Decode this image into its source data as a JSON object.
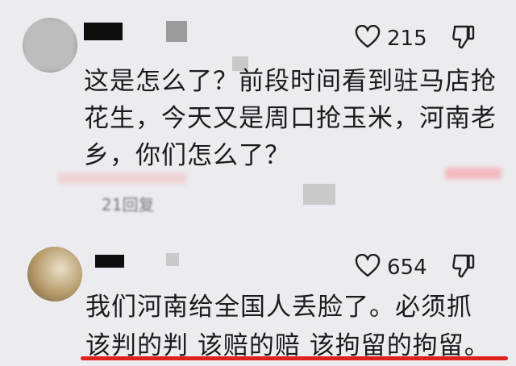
{
  "comments": [
    {
      "likes": "215",
      "text": "这是怎么了？前段时间看到驻马店抢\n花生，今天又是周口抢玉米，河南老\n乡，你们怎么了？",
      "replies": "21回复"
    },
    {
      "likes": "654",
      "text_line1": "我们河南给全国人丢脸了。必须抓",
      "text_line2": "该判的判 该赔的赔 该拘留的拘留。"
    }
  ],
  "icons": {
    "like": "heart-outline-icon",
    "dislike": "thumbs-down-icon"
  },
  "colors": {
    "background": "#ececf0",
    "underline": "#e0201c",
    "redaction": "#0d0d0d"
  }
}
